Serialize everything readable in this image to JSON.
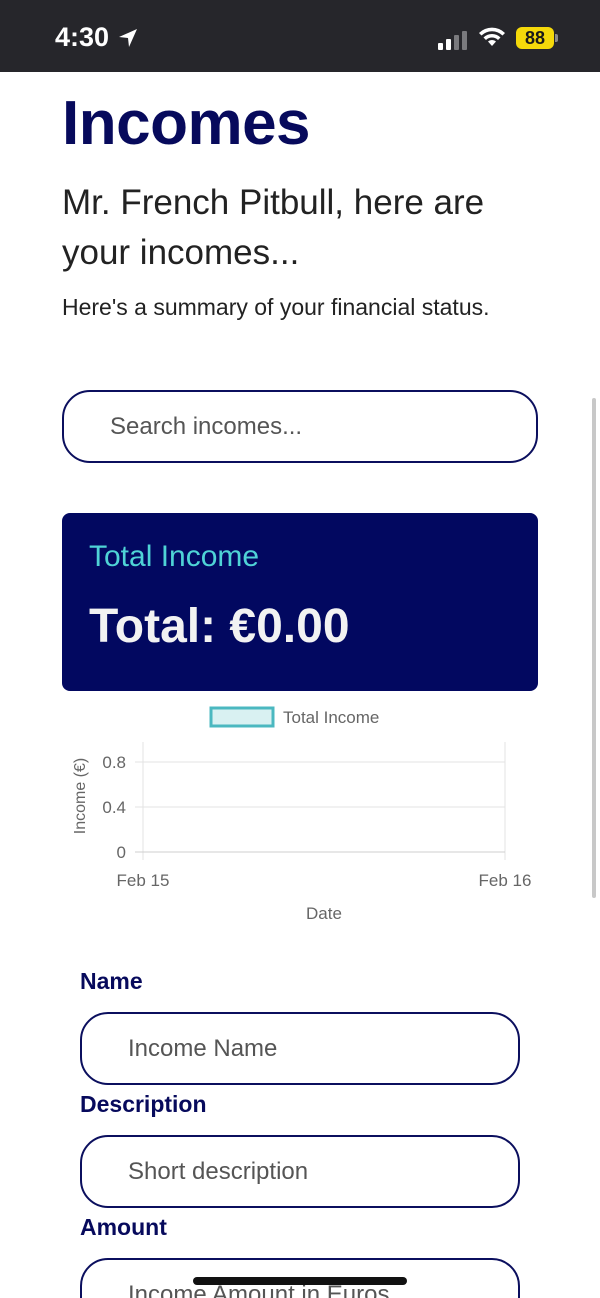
{
  "status_bar": {
    "time": "4:30",
    "battery": "88",
    "icons": [
      "location-arrow-icon",
      "cellular-signal-icon",
      "wifi-icon",
      "battery-icon"
    ]
  },
  "page": {
    "title": "Incomes",
    "greeting": "Mr. French Pitbull, here are your incomes...",
    "summary": "Here's a summary of your financial status."
  },
  "search": {
    "placeholder": "Search incomes..."
  },
  "total_card": {
    "label": "Total Income",
    "value": "Total: €0.00"
  },
  "chart_data": {
    "type": "line",
    "title": "",
    "legend": [
      "Total Income"
    ],
    "legend_position": "top",
    "xlabel": "Date",
    "ylabel": "Income (€)",
    "x": [
      "Feb 15",
      "Feb 16"
    ],
    "ylim": [
      0,
      0.8
    ],
    "y_ticks": [
      "0",
      "0.4",
      "0.8"
    ],
    "series": [
      {
        "name": "Total Income",
        "values": []
      }
    ],
    "grid": true,
    "colors": {
      "series_border": "#4bb8c0",
      "series_fill": "#d9f1f2"
    }
  },
  "form": {
    "name_label": "Name",
    "name_placeholder": "Income Name",
    "description_label": "Description",
    "description_placeholder": "Short description",
    "amount_label": "Amount",
    "amount_placeholder": "Income Amount in Euros"
  },
  "colors": {
    "brand_navy": "#070a5c",
    "card_bg": "#020860",
    "accent_teal": "#4fd3d6"
  }
}
